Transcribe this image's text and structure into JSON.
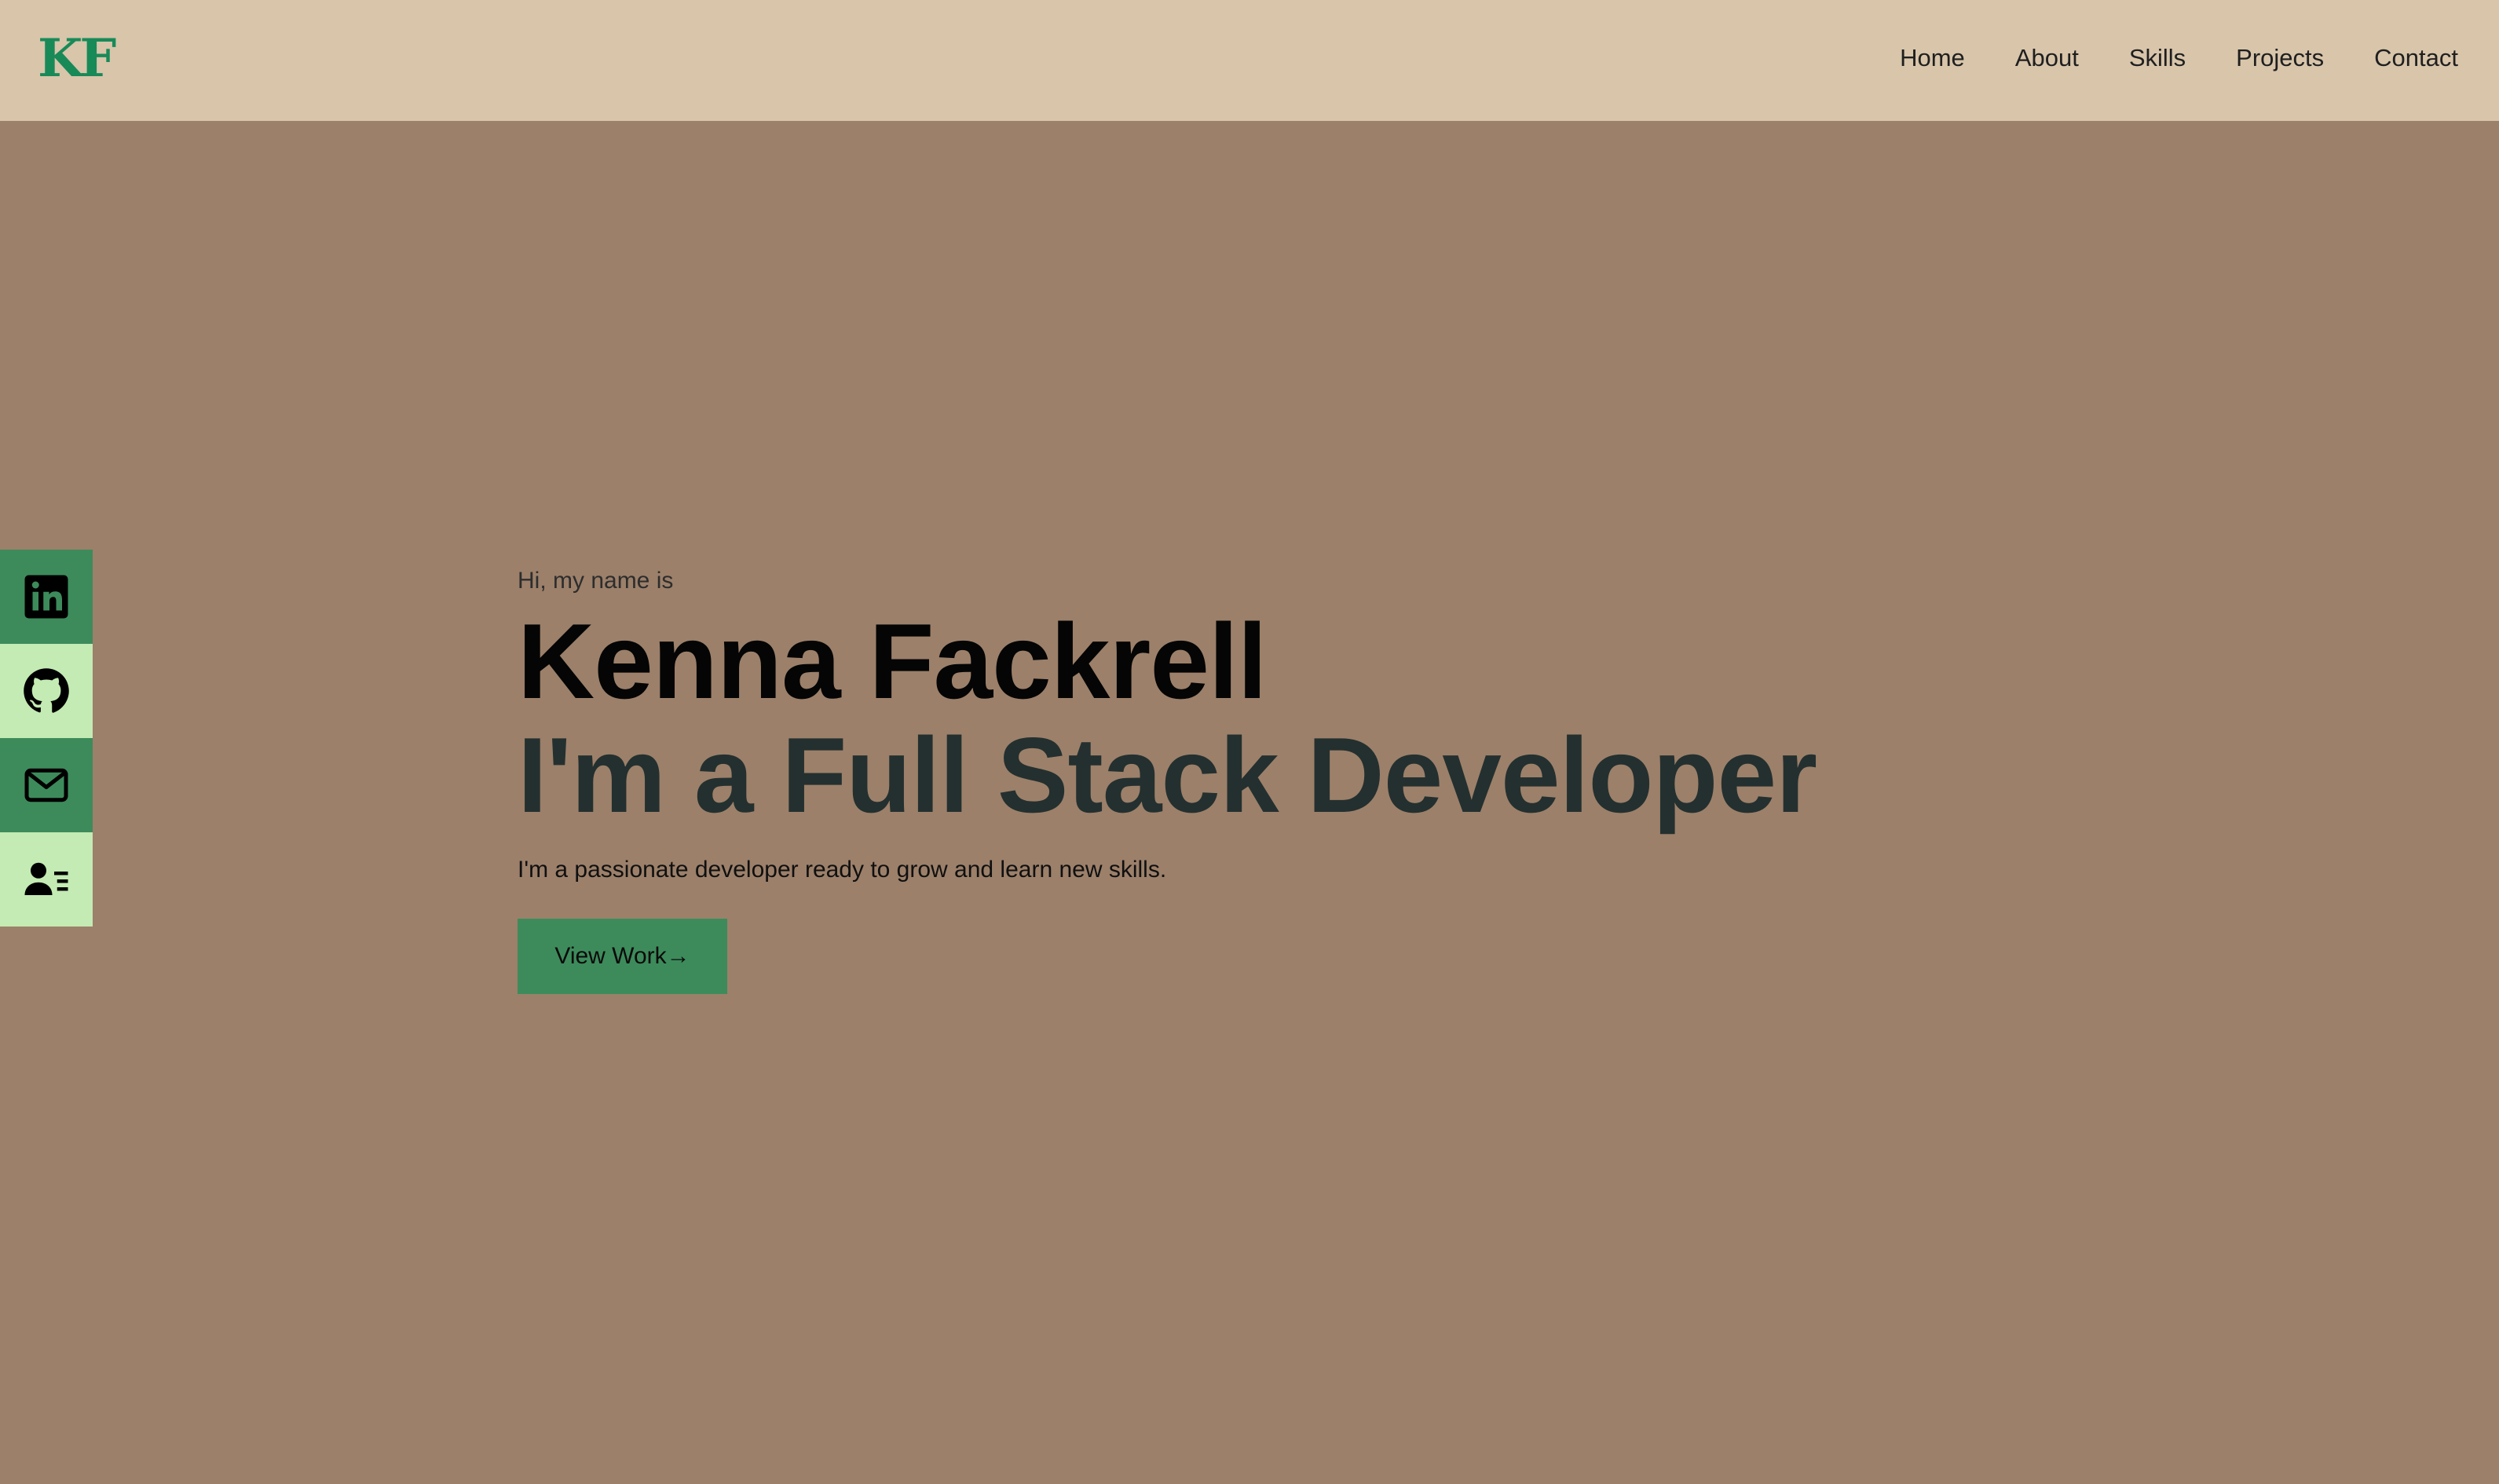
{
  "header": {
    "logo": "KF",
    "nav": [
      "Home",
      "About",
      "Skills",
      "Projects",
      "Contact"
    ]
  },
  "social": [
    {
      "icon": "linkedin-icon",
      "style": "dark"
    },
    {
      "icon": "github-icon",
      "style": "light"
    },
    {
      "icon": "mail-icon",
      "style": "dark"
    },
    {
      "icon": "resume-icon",
      "style": "light"
    }
  ],
  "hero": {
    "intro": "Hi, my name is",
    "name": "Kenna Fackrell",
    "role": "I'm a Full Stack Developer",
    "tagline": "I'm a passionate developer ready to grow and learn new skills.",
    "cta_label": "View Work",
    "cta_arrow": "→"
  },
  "colors": {
    "background": "#9c806a",
    "navbar": "#d8c5aa",
    "logo": "#188a58",
    "accent_dark": "#3d8b5b",
    "accent_light": "#c3ebb3",
    "role_text": "#24302f"
  }
}
